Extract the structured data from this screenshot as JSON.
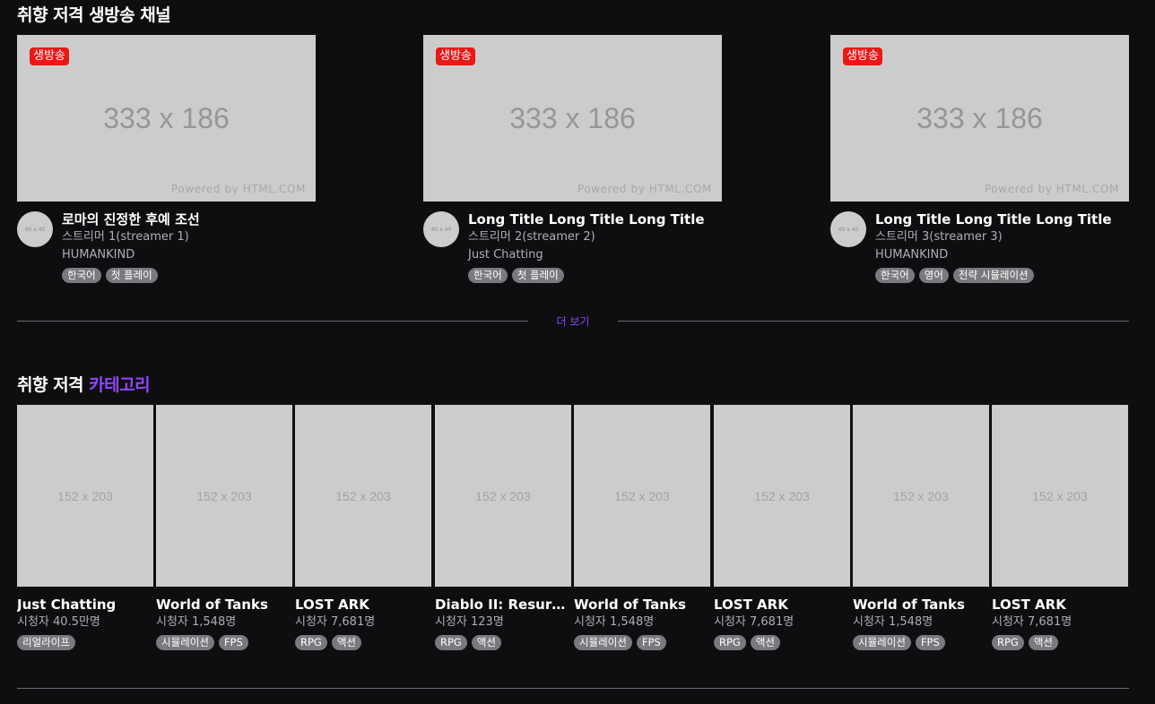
{
  "live_section": {
    "title": "취향 저격 생방송 채널",
    "more_label": "더 보기",
    "channels": [
      {
        "badge": "생방송",
        "thumb_label": "333 x 186",
        "powered_by": "Powered by HTML.COM",
        "avatar_label": "40 x 40",
        "title": "로마의 진정한 후예 조선",
        "streamer": "스트리머 1(streamer 1)",
        "category": "HUMANKIND",
        "tags": [
          "한국어",
          "첫 플레이"
        ]
      },
      {
        "badge": "생방송",
        "thumb_label": "333 x 186",
        "powered_by": "Powered by HTML.COM",
        "avatar_label": "40 x 40",
        "title": "Long Title Long Title Long Title",
        "streamer": "스트리머 2(streamer 2)",
        "category": "Just Chatting",
        "tags": [
          "한국어",
          "첫 플레이"
        ]
      },
      {
        "badge": "생방송",
        "thumb_label": "333 x 186",
        "powered_by": "Powered by HTML.COM",
        "avatar_label": "40 x 40",
        "title": "Long Title Long Title Long Title",
        "streamer": "스트리머 3(streamer 3)",
        "category": "HUMANKIND",
        "tags": [
          "한국어",
          "영어",
          "전략 시뮬레이션"
        ]
      }
    ]
  },
  "category_section": {
    "title_prefix": "취향 저격",
    "title_accent": "카테고리",
    "categories": [
      {
        "thumb_label": "152 x 203",
        "title": "Just Chatting",
        "viewers": "시청자 40.5만명",
        "tags": [
          "리얼라이프"
        ]
      },
      {
        "thumb_label": "152 x 203",
        "title": "World of Tanks",
        "viewers": "시청자 1,548명",
        "tags": [
          "시뮬레이션",
          "FPS"
        ]
      },
      {
        "thumb_label": "152 x 203",
        "title": "LOST ARK",
        "viewers": "시청자 7,681명",
        "tags": [
          "RPG",
          "액션"
        ]
      },
      {
        "thumb_label": "152 x 203",
        "title": "Diablo II: Resurrected",
        "viewers": "시청자 123명",
        "tags": [
          "RPG",
          "액션"
        ]
      },
      {
        "thumb_label": "152 x 203",
        "title": "World of Tanks",
        "viewers": "시청자 1,548명",
        "tags": [
          "시뮬레이션",
          "FPS"
        ]
      },
      {
        "thumb_label": "152 x 203",
        "title": "LOST ARK",
        "viewers": "시청자 7,681명",
        "tags": [
          "RPG",
          "액션"
        ]
      },
      {
        "thumb_label": "152 x 203",
        "title": "World of Tanks",
        "viewers": "시청자 1,548명",
        "tags": [
          "시뮬레이션",
          "FPS"
        ]
      },
      {
        "thumb_label": "152 x 203",
        "title": "LOST ARK",
        "viewers": "시청자 7,681명",
        "tags": [
          "RPG",
          "액션"
        ]
      }
    ]
  },
  "colors": {
    "background": "#0e0e10",
    "accent": "#9147ff",
    "live_badge": "#e91916",
    "placeholder": "#cccccc",
    "tag_bg": "#7a7a7e"
  }
}
